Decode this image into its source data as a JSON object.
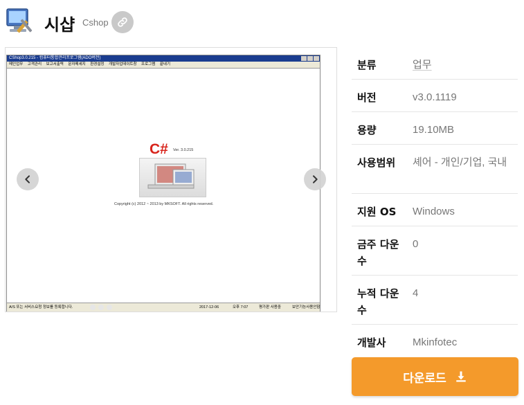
{
  "app": {
    "title": "시샵",
    "subtitle": "Cshop",
    "icon": "computer-tools-icon",
    "link_icon": "link-icon"
  },
  "screenshot": {
    "window_title": "CShop3.0.215 - 컴퓨터통합관리프로그램(ADO버전)",
    "menu": [
      "메인업무",
      "고객관리",
      "보고서출력",
      "문자메세지",
      "환경설정",
      "개발자업데이트창",
      "프로그램",
      "끝내기"
    ],
    "logo": "C#",
    "version": "Ver. 3.0.215",
    "copyright": "Copyright (c) 2012 ~ 2013 by MKSOFT. All rights reserved.",
    "status_left": "A/S 또는 서비스요청 정보를 등록합니다.",
    "status_date": "2017-12-06",
    "status_time": "오후 7:07",
    "status_user": "평가판 사용중",
    "status_right": "보안기능사용안함"
  },
  "info": [
    {
      "label": "분류",
      "value": "업무"
    },
    {
      "label": "버전",
      "value": "v3.0.1119"
    },
    {
      "label": "용량",
      "value": "19.10MB"
    },
    {
      "label": "사용범위",
      "value": "셰어 - 개인/기업, 국내"
    },
    {
      "label": "지원 OS",
      "value": "Windows"
    },
    {
      "label": "금주 다운수",
      "value": "0"
    },
    {
      "label": "누적 다운수",
      "value": "4"
    },
    {
      "label": "개발사",
      "value": "Mkinfotec"
    }
  ],
  "download": {
    "label": "다운로드",
    "icon": "download-icon"
  },
  "colors": {
    "accent": "#f49a2b",
    "muted": "#777777"
  }
}
